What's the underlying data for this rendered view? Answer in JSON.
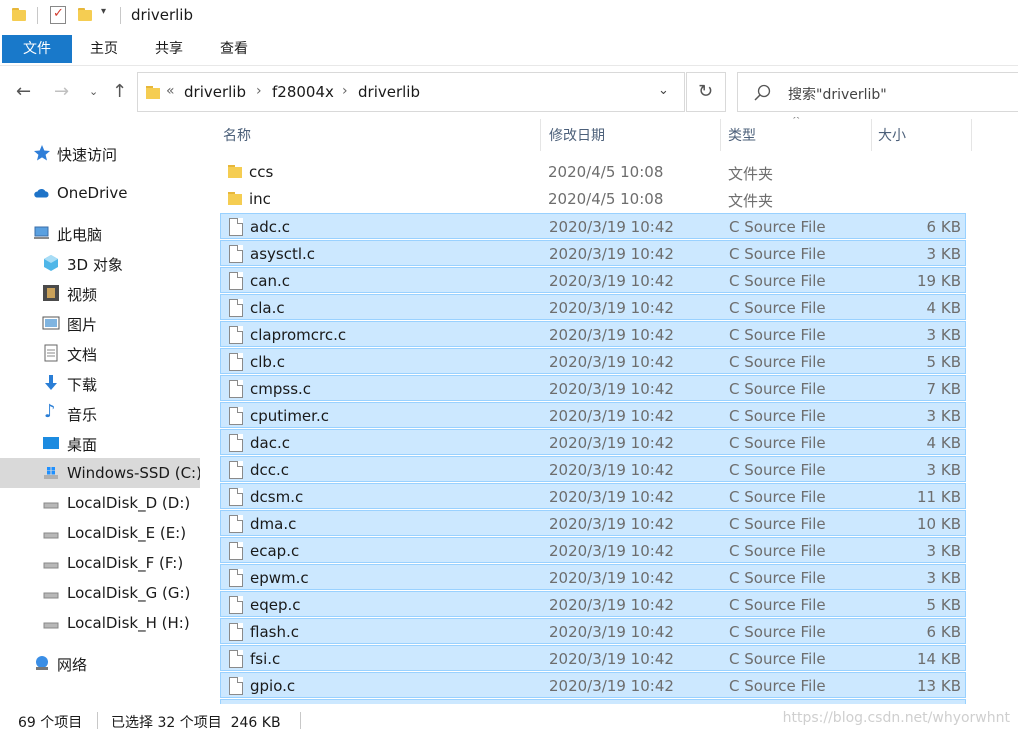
{
  "window": {
    "title": "driverlib",
    "quick_access_dropdown": "▾"
  },
  "ribbon": {
    "tabs": [
      "文件",
      "主页",
      "共享",
      "查看"
    ]
  },
  "address": {
    "overflow": "«",
    "crumbs": [
      "driverlib",
      "f28004x",
      "driverlib"
    ],
    "separator": "›",
    "search_placeholder": "搜索\"driverlib\""
  },
  "nav": {
    "quick_access": "快速访问",
    "onedrive": "OneDrive",
    "this_pc": "此电脑",
    "items": [
      "3D 对象",
      "视频",
      "图片",
      "文档",
      "下载",
      "音乐",
      "桌面"
    ],
    "drives": [
      "Windows-SSD (C:)",
      "LocalDisk_D (D:)",
      "LocalDisk_E (E:)",
      "LocalDisk_F (F:)",
      "LocalDisk_G (G:)",
      "LocalDisk_H (H:)"
    ],
    "network": "网络"
  },
  "list": {
    "headers": {
      "name": "名称",
      "date": "修改日期",
      "type": "类型",
      "size": "大小"
    },
    "folders": [
      {
        "name": "ccs",
        "date": "2020/4/5 10:08",
        "type": "文件夹"
      },
      {
        "name": "inc",
        "date": "2020/4/5 10:08",
        "type": "文件夹"
      }
    ],
    "files": [
      {
        "name": "adc.c",
        "date": "2020/3/19 10:42",
        "type": "C Source File",
        "size": "6 KB"
      },
      {
        "name": "asysctl.c",
        "date": "2020/3/19 10:42",
        "type": "C Source File",
        "size": "3 KB"
      },
      {
        "name": "can.c",
        "date": "2020/3/19 10:42",
        "type": "C Source File",
        "size": "19 KB"
      },
      {
        "name": "cla.c",
        "date": "2020/3/19 10:42",
        "type": "C Source File",
        "size": "4 KB"
      },
      {
        "name": "clapromcrc.c",
        "date": "2020/3/19 10:42",
        "type": "C Source File",
        "size": "3 KB"
      },
      {
        "name": "clb.c",
        "date": "2020/3/19 10:42",
        "type": "C Source File",
        "size": "5 KB"
      },
      {
        "name": "cmpss.c",
        "date": "2020/3/19 10:42",
        "type": "C Source File",
        "size": "7 KB"
      },
      {
        "name": "cputimer.c",
        "date": "2020/3/19 10:42",
        "type": "C Source File",
        "size": "3 KB"
      },
      {
        "name": "dac.c",
        "date": "2020/3/19 10:42",
        "type": "C Source File",
        "size": "4 KB"
      },
      {
        "name": "dcc.c",
        "date": "2020/3/19 10:42",
        "type": "C Source File",
        "size": "3 KB"
      },
      {
        "name": "dcsm.c",
        "date": "2020/3/19 10:42",
        "type": "C Source File",
        "size": "11 KB"
      },
      {
        "name": "dma.c",
        "date": "2020/3/19 10:42",
        "type": "C Source File",
        "size": "10 KB"
      },
      {
        "name": "ecap.c",
        "date": "2020/3/19 10:42",
        "type": "C Source File",
        "size": "3 KB"
      },
      {
        "name": "epwm.c",
        "date": "2020/3/19 10:42",
        "type": "C Source File",
        "size": "3 KB"
      },
      {
        "name": "eqep.c",
        "date": "2020/3/19 10:42",
        "type": "C Source File",
        "size": "5 KB"
      },
      {
        "name": "flash.c",
        "date": "2020/3/19 10:42",
        "type": "C Source File",
        "size": "6 KB"
      },
      {
        "name": "fsi.c",
        "date": "2020/3/19 10:42",
        "type": "C Source File",
        "size": "14 KB"
      },
      {
        "name": "gpio.c",
        "date": "2020/3/19 10:42",
        "type": "C Source File",
        "size": "13 KB"
      }
    ]
  },
  "status": {
    "count": "69 个项目",
    "selection": "已选择 32 个项目  246 KB",
    "watermark": "https://blog.csdn.net/whyorwhnt"
  },
  "colors": {
    "accent": "#1979ca",
    "selection_fill": "#cce8ff",
    "selection_border": "#99d1ff",
    "nav_selected": "#d9d9d9"
  }
}
